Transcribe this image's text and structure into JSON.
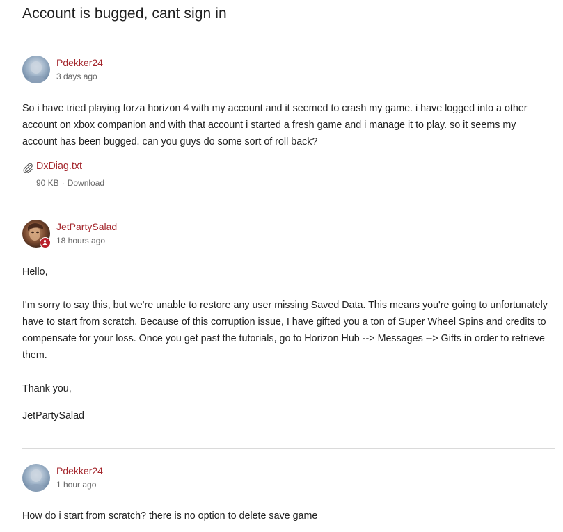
{
  "thread": {
    "title": "Account is bugged, cant sign in"
  },
  "posts": [
    {
      "author": "Pdekker24",
      "time": "3 days ago",
      "body": "So i have tried playing forza horizon 4 with my account and it seemed to crash my game. i have logged into a other account on xbox companion and with that account i started a fresh game and i manage it to play. so it seems my account has been bugged. can you guys do some sort of roll back?",
      "attachment": {
        "name": "DxDiag.txt",
        "size": "90 KB",
        "separator": "·",
        "action": "Download"
      }
    },
    {
      "author": "JetPartySalad",
      "time": "18 hours ago",
      "paragraphs": [
        "Hello,",
        "I'm sorry to say this, but we're unable to restore any user missing Saved Data. This means you're going to unfortunately have to start from scratch. Because of this corruption issue, I have gifted you a ton of Super Wheel Spins and credits to compensate for your loss. Once you get past the tutorials, go to Horizon Hub --> Messages --> Gifts in order to retrieve them.",
        "Thank you,",
        "JetPartySalad"
      ],
      "badge": "moderator"
    },
    {
      "author": "Pdekker24",
      "time": "1 hour ago",
      "body": "How do i start from scratch? there is no option to delete save game"
    }
  ],
  "colors": {
    "accent": "#a4262c",
    "badge": "#b8202b",
    "divider": "#dadada",
    "muted": "#666666"
  },
  "icons": {
    "attachment": "paperclip-icon",
    "badge": "moderator-badge-icon"
  }
}
